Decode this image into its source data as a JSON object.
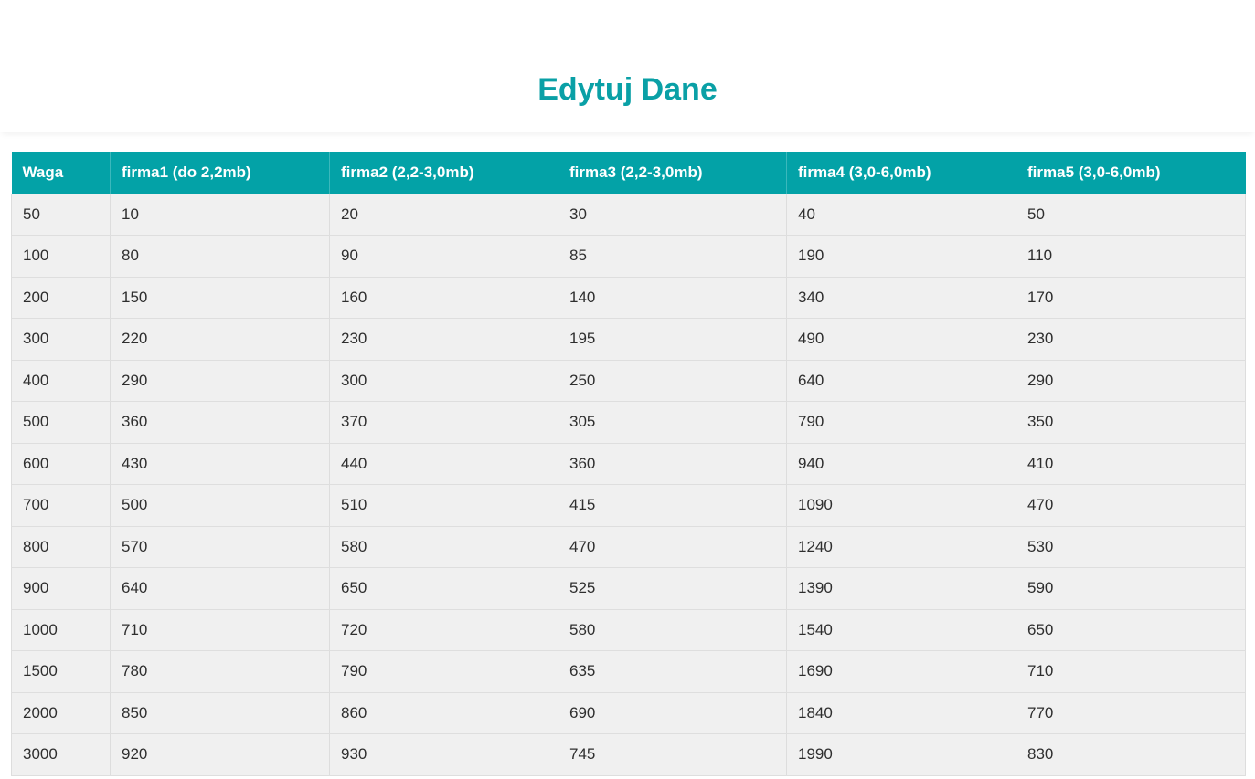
{
  "page": {
    "title": "Edytuj Dane"
  },
  "table": {
    "headers": [
      "Waga",
      "firma1 (do 2,2mb)",
      "firma2 (2,2-3,0mb)",
      "firma3 (2,2-3,0mb)",
      "firma4 (3,0-6,0mb)",
      "firma5 (3,0-6,0mb)"
    ],
    "rows": [
      [
        "50",
        "10",
        "20",
        "30",
        "40",
        "50"
      ],
      [
        "100",
        "80",
        "90",
        "85",
        "190",
        "110"
      ],
      [
        "200",
        "150",
        "160",
        "140",
        "340",
        "170"
      ],
      [
        "300",
        "220",
        "230",
        "195",
        "490",
        "230"
      ],
      [
        "400",
        "290",
        "300",
        "250",
        "640",
        "290"
      ],
      [
        "500",
        "360",
        "370",
        "305",
        "790",
        "350"
      ],
      [
        "600",
        "430",
        "440",
        "360",
        "940",
        "410"
      ],
      [
        "700",
        "500",
        "510",
        "415",
        "1090",
        "470"
      ],
      [
        "800",
        "570",
        "580",
        "470",
        "1240",
        "530"
      ],
      [
        "900",
        "640",
        "650",
        "525",
        "1390",
        "590"
      ],
      [
        "1000",
        "710",
        "720",
        "580",
        "1540",
        "650"
      ],
      [
        "1500",
        "780",
        "790",
        "635",
        "1690",
        "710"
      ],
      [
        "2000",
        "850",
        "860",
        "690",
        "1840",
        "770"
      ],
      [
        "3000",
        "920",
        "930",
        "745",
        "1990",
        "830"
      ]
    ]
  },
  "colors": {
    "accent": "#03a2a7",
    "title": "#0aa0a6",
    "row_bg": "#f0f0f0"
  }
}
